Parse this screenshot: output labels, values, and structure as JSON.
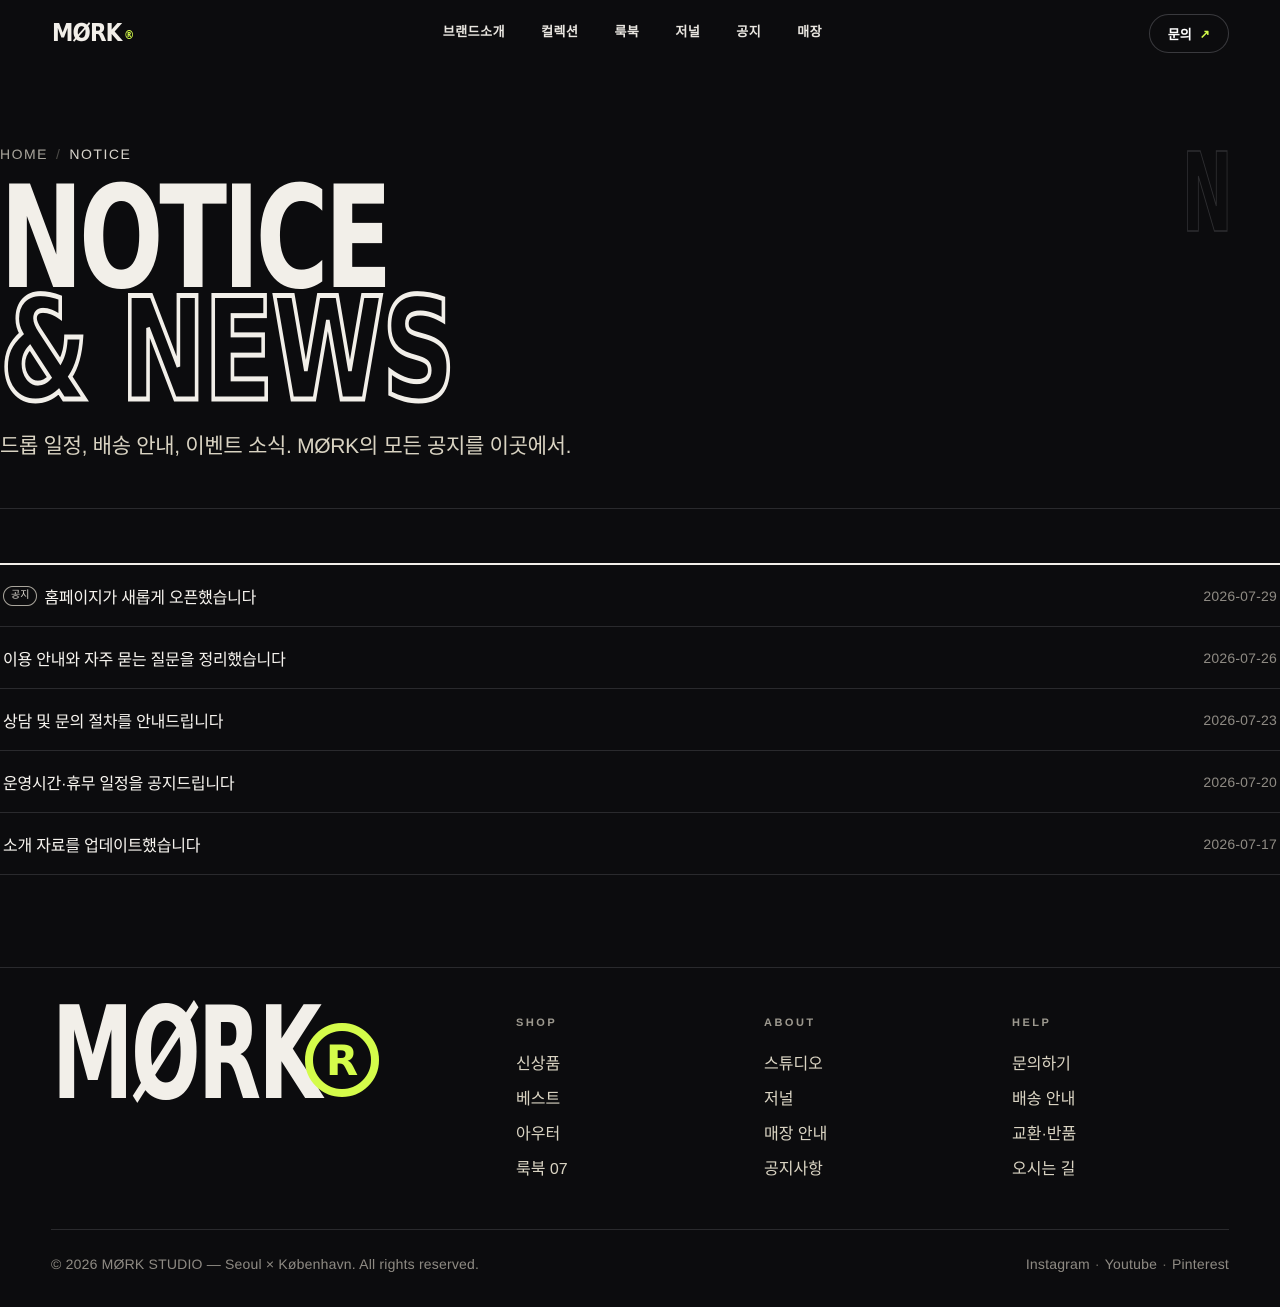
{
  "header": {
    "logo": "MØRK",
    "logo_mark": "®",
    "nav": [
      "브랜드소개",
      "컬렉션",
      "룩북",
      "저널",
      "공지",
      "매장"
    ],
    "contact_label": "문의",
    "contact_arrow": "↗"
  },
  "hero": {
    "breadcrumb": [
      "HOME",
      "NOTICE"
    ],
    "breadcrumb_sep": "/",
    "title_line1": "NOTICE",
    "title_line2": "& NEWS",
    "ghost_letter": "N",
    "subtitle": "드롭 일정, 배송 안내, 이벤트 소식. MØRK의 모든 공지를 이곳에서."
  },
  "notices": [
    {
      "tag": "공지",
      "title": "홈페이지가 새롭게 오픈했습니다",
      "date": "2026-07-29"
    },
    {
      "tag": "",
      "title": "이용 안내와 자주 묻는 질문을 정리했습니다",
      "date": "2026-07-26"
    },
    {
      "tag": "",
      "title": "상담 및 문의 절차를 안내드립니다",
      "date": "2026-07-23"
    },
    {
      "tag": "",
      "title": "운영시간·휴무 일정을 공지드립니다",
      "date": "2026-07-20"
    },
    {
      "tag": "",
      "title": "소개 자료를 업데이트했습니다",
      "date": "2026-07-17"
    }
  ],
  "footer": {
    "logo": "MØRK",
    "logo_mark": "R",
    "columns": [
      {
        "heading": "SHOP",
        "links": [
          "신상품",
          "베스트",
          "아우터",
          "룩북 07"
        ]
      },
      {
        "heading": "ABOUT",
        "links": [
          "스튜디오",
          "저널",
          "매장 안내",
          "공지사항"
        ]
      },
      {
        "heading": "HELP",
        "links": [
          "문의하기",
          "배송 안내",
          "교환·반품",
          "오시는 길"
        ]
      }
    ],
    "copyright": "© 2026 MØRK STUDIO — Seoul × København. All rights reserved.",
    "socials": [
      "Instagram",
      "Youtube",
      "Pinterest"
    ],
    "social_sep": "·"
  },
  "colors": {
    "background": "#0c0c0e",
    "text": "#f2efe9",
    "accent": "#d4fc4a",
    "muted": "#8e8a83"
  }
}
